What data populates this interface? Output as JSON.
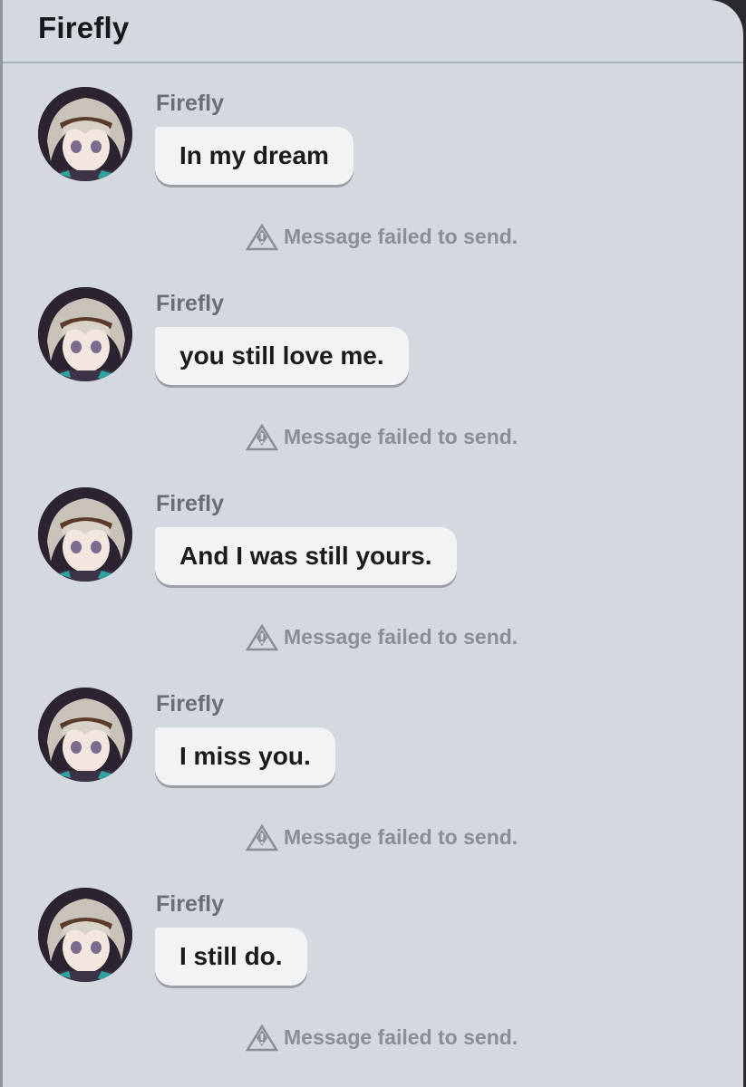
{
  "header": {
    "title": "Firefly"
  },
  "messages": [
    {
      "sender": "Firefly",
      "text": "In my dream",
      "status": "Message failed to send."
    },
    {
      "sender": "Firefly",
      "text": "you still love me.",
      "status": "Message failed to send."
    },
    {
      "sender": "Firefly",
      "text": "And I was still yours.",
      "status": "Message failed to send."
    },
    {
      "sender": "Firefly",
      "text": "I miss you.",
      "status": "Message failed to send."
    },
    {
      "sender": "Firefly",
      "text": "I still do.",
      "status": "Message failed to send."
    }
  ],
  "icons": {
    "avatar": "firefly-avatar-image",
    "failed": "warning-diamond-icon"
  },
  "colors": {
    "background": "#d4d9df",
    "bubble": "#f2f3f5",
    "failed_text": "#8b8e92"
  }
}
